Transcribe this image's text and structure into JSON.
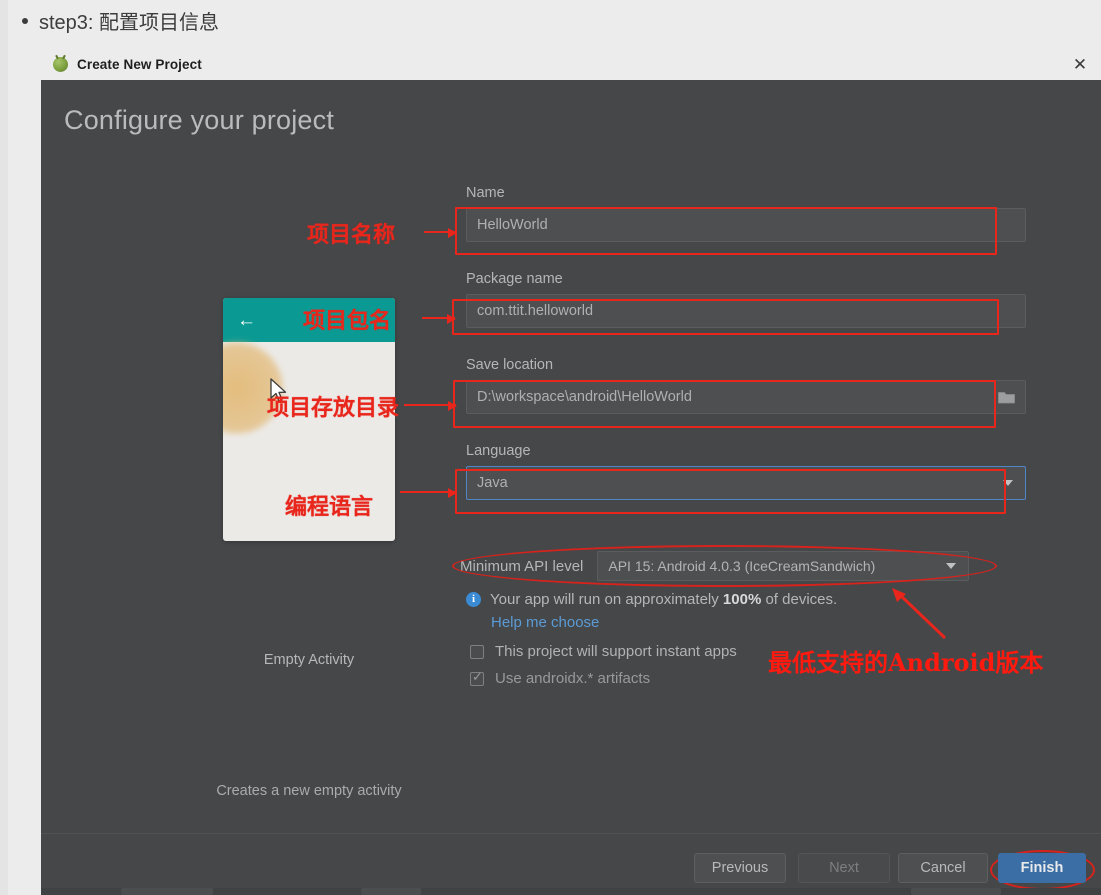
{
  "document": {
    "bullet_text": "step3: 配置项目信息"
  },
  "window": {
    "title": "Create New Project",
    "app_icon": "android-studio-icon",
    "close_icon": "close-icon"
  },
  "dialog": {
    "heading": "Configure your project"
  },
  "preview": {
    "back_icon": "back-arrow-icon",
    "cursor_icon": "mouse-cursor-icon",
    "label": "Empty Activity",
    "description": "Creates a new empty activity"
  },
  "form": {
    "name": {
      "label": "Name",
      "value": "HelloWorld"
    },
    "package": {
      "label": "Package name",
      "value": "com.ttit.helloworld"
    },
    "save_location": {
      "label": "Save location",
      "value": "D:\\workspace\\android\\HelloWorld",
      "browse_icon": "folder-icon"
    },
    "language": {
      "label": "Language",
      "value": "Java",
      "caret_icon": "chevron-down-icon"
    },
    "min_api": {
      "label": "Minimum API level",
      "value": "API 15: Android 4.0.3 (IceCreamSandwich)",
      "caret_icon": "chevron-down-icon"
    },
    "info": {
      "icon": "info-icon",
      "prefix": "Your app will run on approximately ",
      "percent": "100%",
      "suffix": " of devices.",
      "help_link": "Help me choose"
    },
    "checkboxes": [
      {
        "label": "This project will support instant apps",
        "checked": false
      },
      {
        "label": "Use androidx.* artifacts",
        "checked": true
      }
    ]
  },
  "annotations": {
    "name_cn": "项目名称",
    "package_cn": "项目包名",
    "location_cn": "项目存放目录",
    "language_cn": "编程语言",
    "api_cn": "最低支持的Android版本"
  },
  "footer": {
    "previous": "Previous",
    "next": "Next",
    "cancel": "Cancel",
    "finish": "Finish"
  },
  "colors": {
    "dialog_bg": "#454749",
    "annotation_red": "#e8261c",
    "primary_blue": "#3b6ea5",
    "link_blue": "#5b9bd5",
    "appbar_teal": "#0b9a93",
    "focus_blue": "#4f86c6"
  }
}
